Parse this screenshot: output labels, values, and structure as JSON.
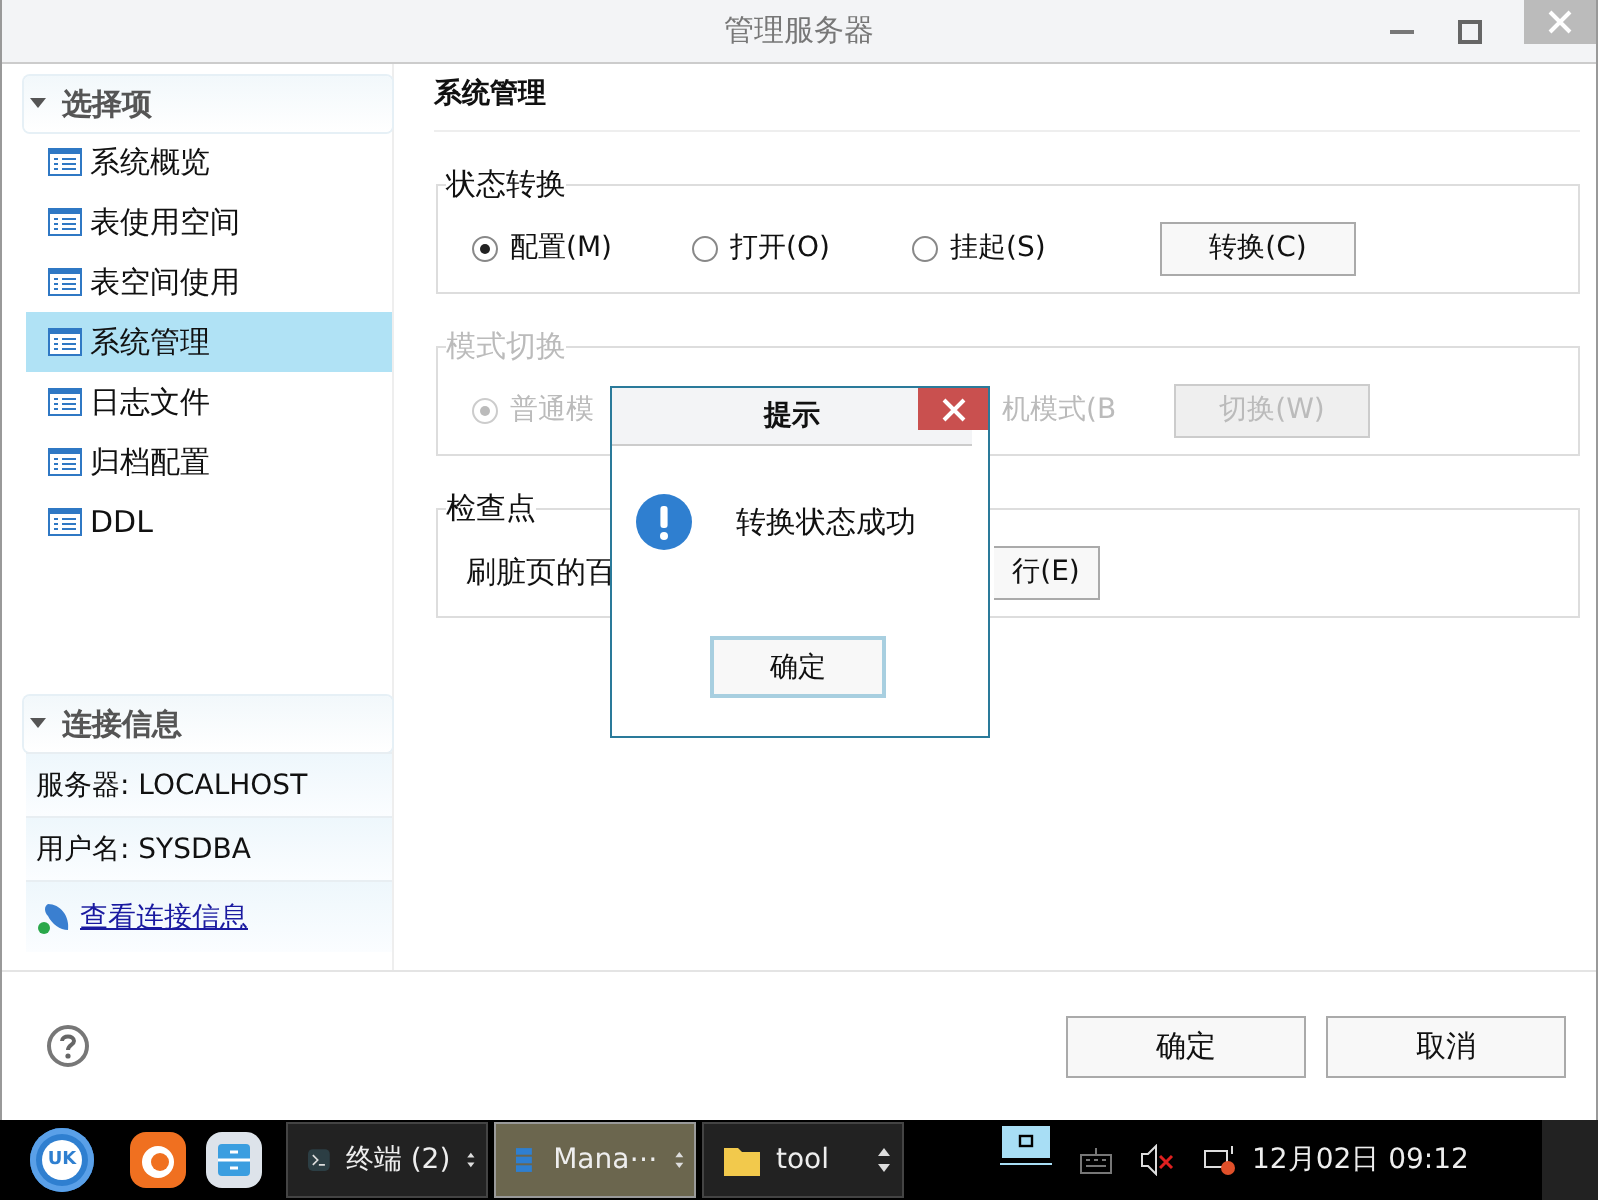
{
  "window": {
    "title": "管理服务器"
  },
  "sidebar": {
    "options": {
      "title": "选择项",
      "expanded": true,
      "items": [
        {
          "label": "系统概览",
          "selected": false
        },
        {
          "label": "表使用空间",
          "selected": false
        },
        {
          "label": "表空间使用",
          "selected": false
        },
        {
          "label": "系统管理",
          "selected": true
        },
        {
          "label": "日志文件",
          "selected": false
        },
        {
          "label": "归档配置",
          "selected": false
        },
        {
          "label": "DDL",
          "selected": false
        }
      ]
    },
    "connection": {
      "title": "连接信息",
      "expanded": true,
      "rows": [
        "服务器: LOCALHOST",
        "用户名: SYSDBA"
      ],
      "link": "查看连接信息"
    }
  },
  "content": {
    "title": "系统管理",
    "state_group": {
      "title": "状态转换",
      "radios": [
        {
          "label": "配置(M)",
          "selected": true
        },
        {
          "label": "打开(O)",
          "selected": false
        },
        {
          "label": "挂起(S)",
          "selected": false
        }
      ],
      "button": "转换(C)"
    },
    "mode_group": {
      "title": "模式切换",
      "disabled": true,
      "radio": {
        "label": "普通模",
        "selected": true
      },
      "radio_2_label": "机模式(B",
      "button": "切换(W)"
    },
    "checkpoint_group": {
      "title": "检查点",
      "label": "刷脏页的百",
      "button": "行(E)"
    }
  },
  "footer": {
    "buttons": [
      "确定",
      "取消"
    ]
  },
  "dialog": {
    "title": "提示",
    "message": "转换状态成功",
    "button": "确定"
  },
  "taskbar": {
    "start_label": "UK",
    "tasks": [
      {
        "label": "终端 (2)",
        "selected": false
      },
      {
        "label": "Mana⋯",
        "selected": true
      },
      {
        "label": "tool",
        "selected": false
      }
    ],
    "clock": "12月02日 09:12"
  }
}
